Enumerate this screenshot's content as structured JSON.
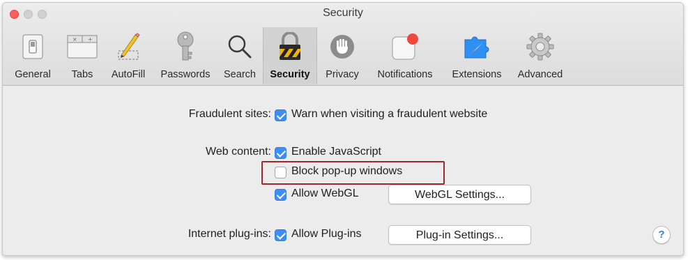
{
  "window": {
    "title": "Security"
  },
  "toolbar": {
    "tabs": [
      {
        "label": "General",
        "icon": "switch-icon"
      },
      {
        "label": "Tabs",
        "icon": "tabs-icon"
      },
      {
        "label": "AutoFill",
        "icon": "pencil-icon"
      },
      {
        "label": "Passwords",
        "icon": "key-icon"
      },
      {
        "label": "Search",
        "icon": "magnifier-icon"
      },
      {
        "label": "Security",
        "icon": "lock-icon"
      },
      {
        "label": "Privacy",
        "icon": "hand-icon"
      },
      {
        "label": "Notifications",
        "icon": "notification-badge-icon"
      },
      {
        "label": "Extensions",
        "icon": "puzzle-icon"
      },
      {
        "label": "Advanced",
        "icon": "gear-icon"
      }
    ],
    "selected": "Security"
  },
  "settings": {
    "fraudulent": {
      "label": "Fraudulent sites:",
      "option": "Warn when visiting a fraudulent website",
      "checked": true
    },
    "web_content": {
      "label": "Web content:",
      "options": [
        {
          "text": "Enable JavaScript",
          "checked": true
        },
        {
          "text": "Block pop-up windows",
          "checked": false
        },
        {
          "text": "Allow WebGL",
          "checked": true
        }
      ],
      "webgl_button": "WebGL Settings..."
    },
    "plugins": {
      "label": "Internet plug-ins:",
      "option": "Allow Plug-ins",
      "checked": true,
      "button": "Plug-in Settings..."
    }
  },
  "help": {
    "label": "?"
  },
  "colors": {
    "accent": "#3b8ff6",
    "highlight_border": "#a8262a"
  }
}
